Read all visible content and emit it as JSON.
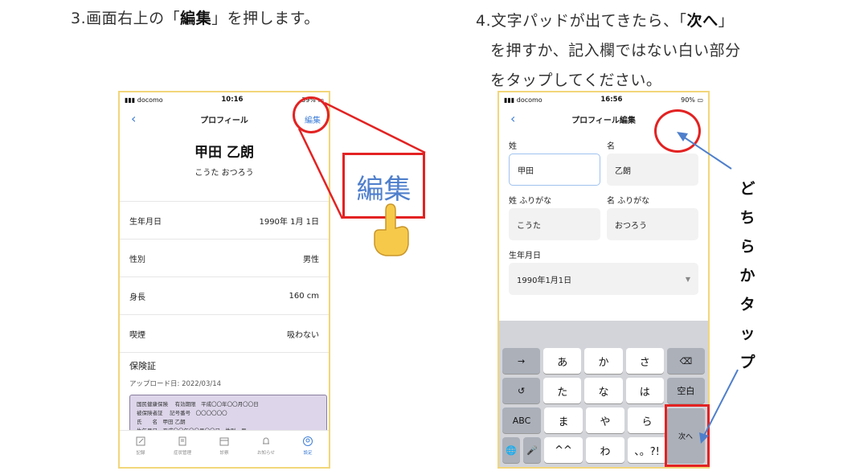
{
  "step3": {
    "prefix": "3.画面右上の「",
    "bold": "編集",
    "suffix": "」を押します。"
  },
  "step4": {
    "prefix": "4.文字パッドが出てきたら、「",
    "bold": "次へ",
    "suffix": "」",
    "line2": "を押すか、記入欄ではない白い部分",
    "line3": "をタップしてください。"
  },
  "phone1": {
    "carrier": "docomo",
    "time": "10:16",
    "battery": "39%",
    "back": "‹",
    "title": "プロフィール",
    "edit": "編集",
    "name": "甲田 乙朗",
    "kana": "こうた おつろう",
    "rows": [
      {
        "label": "生年月日",
        "value": "1990年 1月 1日"
      },
      {
        "label": "性別",
        "value": "男性"
      },
      {
        "label": "身長",
        "value": "160 cm"
      },
      {
        "label": "喫煙",
        "value": "吸わない"
      }
    ],
    "insurance_title": "保険証",
    "insurance_date": "アップロード日: 2022/03/14",
    "card_lines": [
      "国民健康保険 　有効期限　平成〇〇年〇〇月〇〇日",
      "被保険者証 　記号番号　〇〇〇〇〇〇",
      "氏　　名　甲田 乙朗",
      "生年月日　平成〇〇年〇〇月〇〇日　性別　男"
    ],
    "tabs": [
      "記録",
      "症状管理",
      "診察",
      "お知らせ",
      "設定"
    ]
  },
  "phone2": {
    "carrier": "docomo",
    "time": "16:56",
    "battery": "90%",
    "back": "‹",
    "title": "プロフィール編集",
    "last_name_label": "姓",
    "first_name_label": "名",
    "last_name_value": "甲田",
    "first_name_value": "乙朗",
    "last_kana_label": "姓 ふりがな",
    "first_kana_label": "名 ふりがな",
    "last_kana_value": "こうた",
    "first_kana_value": "おつろう",
    "birth_label": "生年月日",
    "birth_value": "1990年1月1日",
    "keys": {
      "row1": [
        "→",
        "あ",
        "か",
        "さ",
        "⌫"
      ],
      "row2": [
        "↺",
        "た",
        "な",
        "は",
        "空白"
      ],
      "row3": [
        "ABC",
        "ま",
        "や",
        "ら"
      ],
      "row4": [
        "🌐",
        "🎤",
        "^^",
        "わ",
        "、。?!"
      ],
      "next": "次へ"
    }
  },
  "annotation": {
    "zoom_label": "編集",
    "vertical_text": [
      "ど",
      "ち",
      "ら",
      "か",
      "タ",
      "ッ",
      "プ"
    ],
    "accent_color": "#e32222",
    "arrow_color": "#4f7fcc"
  }
}
